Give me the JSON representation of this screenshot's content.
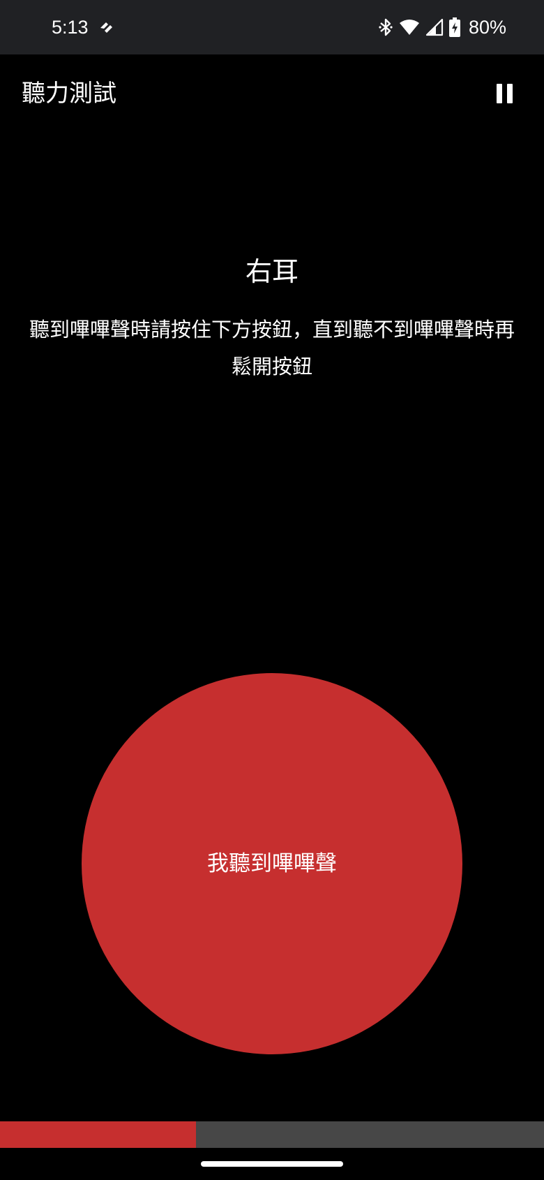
{
  "status_bar": {
    "time": "5:13",
    "battery": "80%",
    "icons": [
      "app-notification-icon",
      "bluetooth-icon",
      "wifi-icon",
      "cell-signal-icon",
      "battery-charging-icon"
    ]
  },
  "app_bar": {
    "title": "聽力測試",
    "action_icon": "pause-icon"
  },
  "test": {
    "ear": "右耳",
    "instruction": "聽到嗶嗶聲時請按住下方按鈕，直到聽不到嗶嗶聲時再鬆開按鈕"
  },
  "beep_button": {
    "label": "我聽到嗶嗶聲"
  },
  "progress": {
    "fraction": 0.36
  },
  "colors": {
    "background": "#000000",
    "status_bar": "#202124",
    "accent": "#c62f2f",
    "progress_track": "#474747",
    "text": "#ffffff"
  }
}
